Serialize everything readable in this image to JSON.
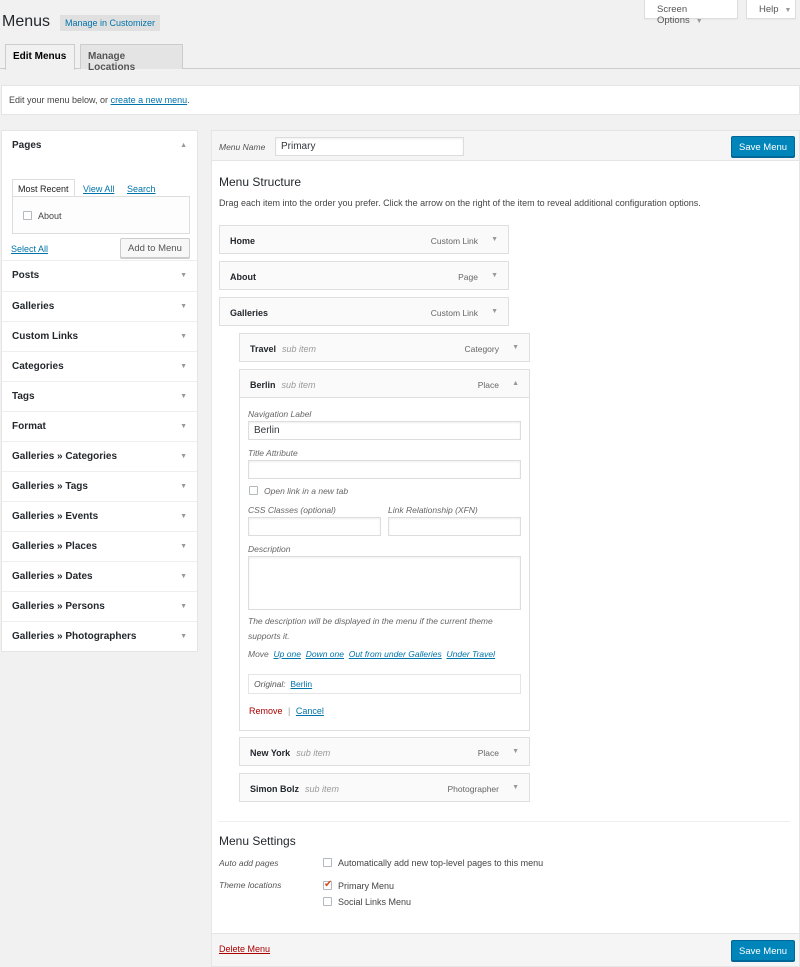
{
  "screen_meta": {
    "screen_options": "Screen Options",
    "help": "Help"
  },
  "header": {
    "title": "Menus",
    "customizer_link": "Manage in Customizer"
  },
  "tabs": [
    {
      "label": "Edit Menus",
      "active": true
    },
    {
      "label": "Manage Locations",
      "active": false
    }
  ],
  "notice": {
    "text": "Edit your menu below, or ",
    "link": "create a new menu",
    "suffix": "."
  },
  "sidebar": {
    "pages": {
      "title": "Pages",
      "tabs": [
        "Most Recent",
        "View All",
        "Search"
      ],
      "items": [
        {
          "label": "About",
          "checked": false
        }
      ],
      "select_all": "Select All",
      "add_button": "Add to Menu"
    },
    "sections": [
      "Posts",
      "Galleries",
      "Custom Links",
      "Categories",
      "Tags",
      "Format",
      "Galleries » Categories",
      "Galleries » Tags",
      "Galleries » Events",
      "Galleries » Places",
      "Galleries » Dates",
      "Galleries » Persons",
      "Galleries » Photographers"
    ]
  },
  "menu": {
    "name_label": "Menu Name",
    "name_value": "Primary",
    "save_button": "Save Menu",
    "structure_title": "Menu Structure",
    "structure_desc": "Drag each item into the order you prefer. Click the arrow on the right of the item to reveal additional configuration options.",
    "sub_item_label": "sub item",
    "items": [
      {
        "title": "Home",
        "type": "Custom Link",
        "depth": 0
      },
      {
        "title": "About",
        "type": "Page",
        "depth": 0
      },
      {
        "title": "Galleries",
        "type": "Custom Link",
        "depth": 0
      },
      {
        "title": "Travel",
        "type": "Category",
        "depth": 1
      },
      {
        "title": "Berlin",
        "type": "Place",
        "depth": 1,
        "expanded": true
      },
      {
        "title": "New York",
        "type": "Place",
        "depth": 1
      },
      {
        "title": "Simon Bolz",
        "type": "Photographer",
        "depth": 1
      }
    ],
    "edit_item": {
      "nav_label": "Navigation Label",
      "nav_value": "Berlin",
      "title_attr": "Title Attribute",
      "title_value": "",
      "new_tab": "Open link in a new tab",
      "css_classes": "CSS Classes (optional)",
      "xfn": "Link Relationship (XFN)",
      "description": "Description",
      "desc_help": "The description will be displayed in the menu if the current theme supports it.",
      "move_label": "Move",
      "move_links": [
        "Up one",
        "Down one",
        "Out from under Galleries",
        "Under Travel"
      ],
      "original_label": "Original:",
      "original_link": "Berlin",
      "remove": "Remove",
      "separator": "|",
      "cancel": "Cancel"
    },
    "settings": {
      "title": "Menu Settings",
      "auto_add_label": "Auto add pages",
      "auto_add_text": "Automatically add new top-level pages to this menu",
      "auto_add_checked": false,
      "locations_label": "Theme locations",
      "locations": [
        {
          "label": "Primary Menu",
          "checked": true
        },
        {
          "label": "Social Links Menu",
          "checked": false
        }
      ]
    },
    "delete_link": "Delete Menu"
  },
  "colors": {
    "primary": "#0085ba",
    "link": "#0073aa",
    "danger": "#aa0000",
    "checkmark": "#d54e21"
  }
}
